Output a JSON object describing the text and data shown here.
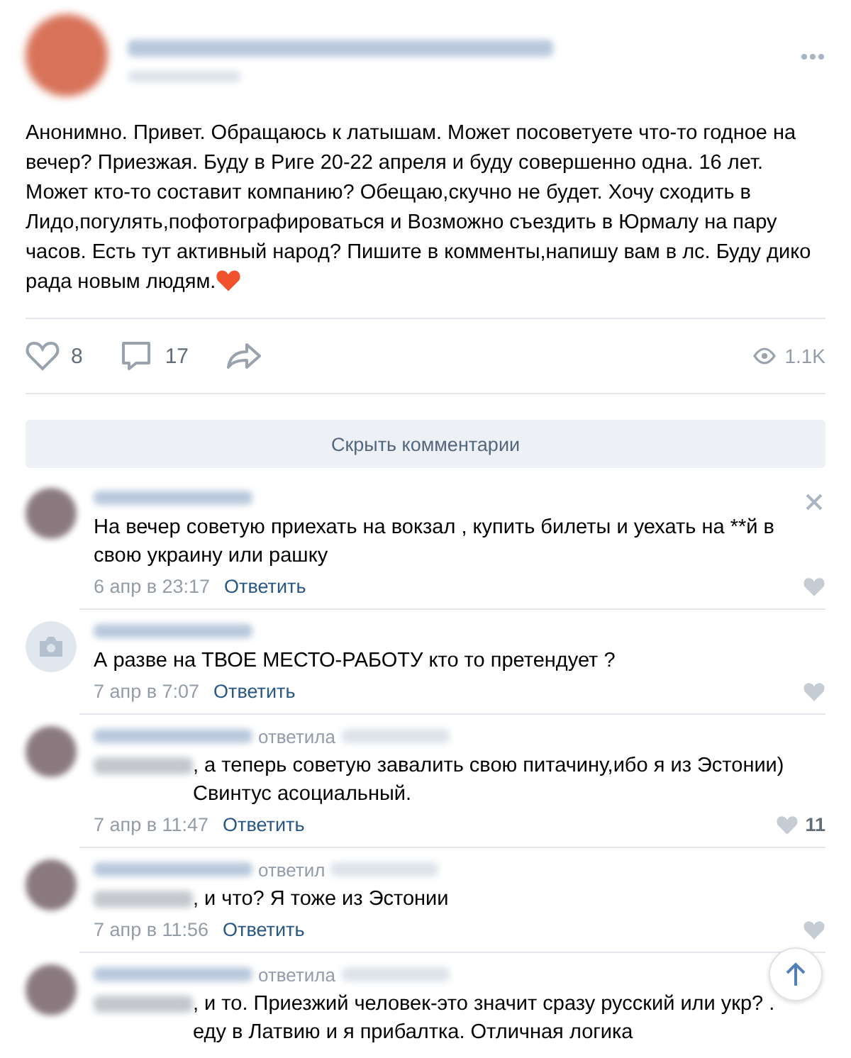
{
  "post": {
    "text": "Анонимно. Привет. Обращаюсь к латышам. Может посоветуете что-то годное на вечер? Приезжая. Буду в Риге 20-22 апреля и буду совершенно одна. 16 лет. Может кто-то составит компанию? Обещаю,скучно не будет. Хочу сходить в Лидо,погулять,пофотографироваться и Возможно съездить в Юрмалу на пару часов. Есть тут активный народ? Пишите в комменты,напишу вам в лс. Буду дико рада новым людям.",
    "likes": "8",
    "comments": "17",
    "views": "1.1K"
  },
  "hide_comments_button": "Скрыть комментарии",
  "comments": [
    {
      "kind": "plain",
      "has_photo": true,
      "text": "На вечер советую приехать на вокзал , купить билеты и уехать на **й в свою украину или рашку",
      "date": "6 апр в 23:17",
      "reply_link": "Ответить",
      "closable": true
    },
    {
      "kind": "plain",
      "has_photo": false,
      "text": "А разве на ТВОЕ МЕСТО-РАБОТУ кто то претендует ?",
      "date": "7 апр в 7:07",
      "reply_link": "Ответить",
      "closable": false
    },
    {
      "kind": "reply",
      "has_photo": true,
      "reply_verb": "ответила",
      "text": ", а теперь советую завалить свою питачину,ибо я из Эстонии) Свинтус асоциальный.",
      "date": "7 апр в 11:47",
      "reply_link": "Ответить",
      "likes": "11",
      "closable": false
    },
    {
      "kind": "reply",
      "has_photo": true,
      "reply_verb": "ответил",
      "text": ", и что? Я тоже из Эстонии",
      "date": "7 апр в 11:56",
      "reply_link": "Ответить",
      "closable": false
    },
    {
      "kind": "reply",
      "has_photo": true,
      "reply_verb": "ответила",
      "text": ", и то. Приезжий человек-это значит сразу русский или укр? . еду в Латвию и я прибалтка. Отличная логика",
      "closable": false
    }
  ]
}
